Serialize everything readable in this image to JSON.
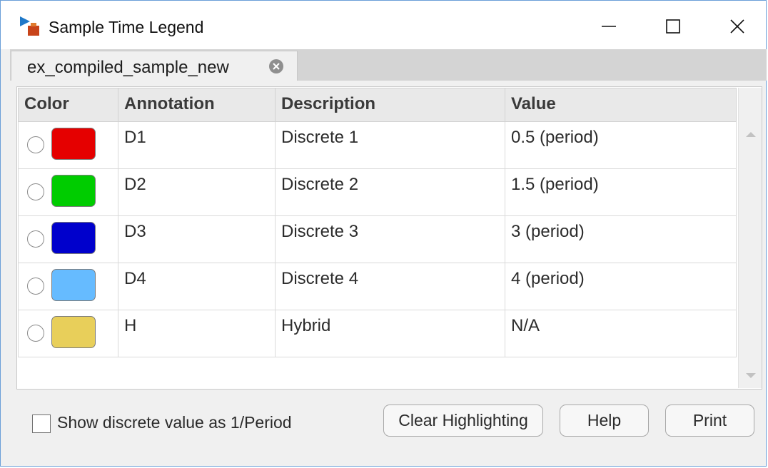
{
  "window": {
    "title": "Sample Time Legend",
    "controls": [
      "minimize",
      "maximize",
      "close"
    ]
  },
  "tabs": [
    {
      "label": "ex_compiled_sample_new",
      "active": true
    }
  ],
  "table": {
    "columns": [
      "Color",
      "Annotation",
      "Description",
      "Value"
    ],
    "rows": [
      {
        "color": "#e50000",
        "annotation": "D1",
        "description": "Discrete 1",
        "value": "0.5 (period)"
      },
      {
        "color": "#00cc00",
        "annotation": "D2",
        "description": "Discrete 2",
        "value": "1.5 (period)"
      },
      {
        "color": "#0000cc",
        "annotation": "D3",
        "description": "Discrete 3",
        "value": "3 (period)"
      },
      {
        "color": "#66bbff",
        "annotation": "D4",
        "description": "Discrete 4",
        "value": "4 (period)"
      },
      {
        "color": "#e8cf5a",
        "annotation": "H",
        "description": "Hybrid",
        "value": "N/A"
      }
    ]
  },
  "footer": {
    "checkbox_label": "Show discrete value as 1/Period",
    "checkbox_checked": false,
    "buttons": {
      "clear": "Clear Highlighting",
      "help": "Help",
      "print": "Print"
    }
  },
  "icons": {
    "app": "simulink-app-icon",
    "tab_close": "close-circle-icon"
  }
}
